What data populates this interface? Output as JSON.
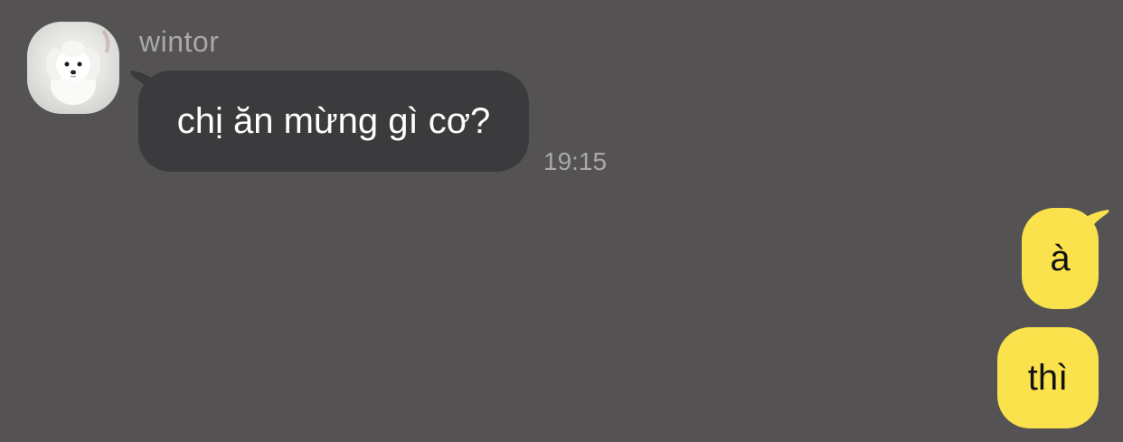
{
  "chat": {
    "incoming": {
      "sender": "wintor",
      "message": "chị ăn mừng gì cơ?",
      "time": "19:15",
      "avatar_icon": "white-puppy-avatar"
    },
    "outgoing": [
      {
        "message": "à"
      },
      {
        "message": "thì"
      }
    ]
  },
  "colors": {
    "background": "#545253",
    "incoming_bubble": "#3b3a3c",
    "outgoing_bubble": "#f9e24b",
    "meta_text": "#a9a7a8"
  }
}
